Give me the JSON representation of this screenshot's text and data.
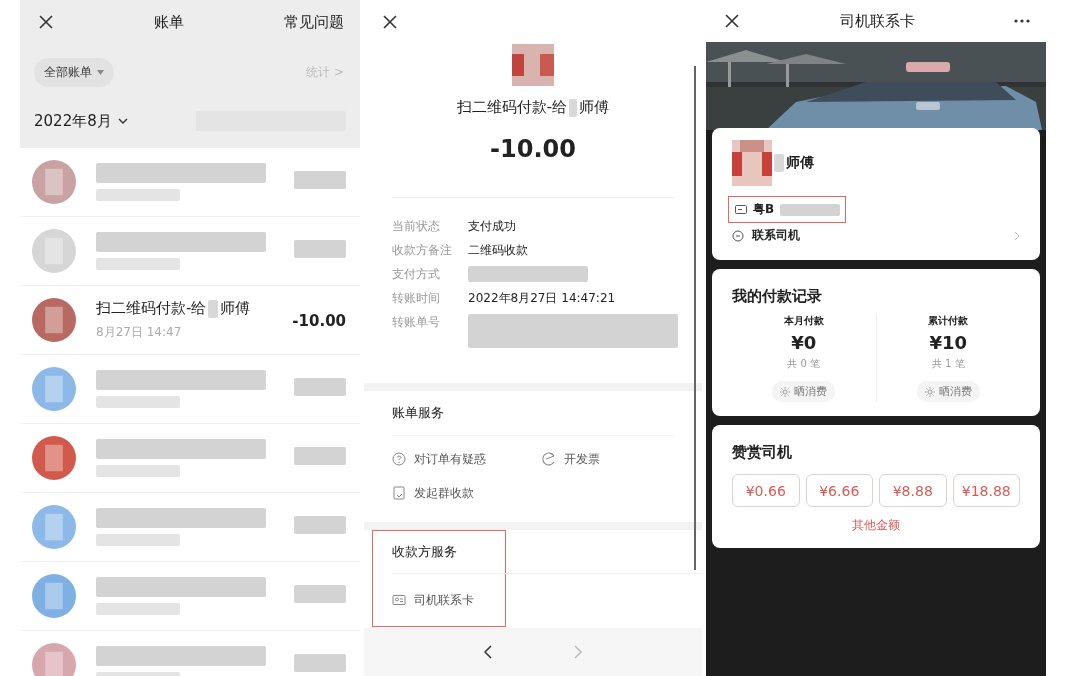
{
  "bill_list": {
    "title": "账单",
    "faq_link": "常见问题",
    "filter": "全部账单",
    "stats_link": "统计 >",
    "month": "2022年8月",
    "rows": [
      {
        "kind": "redacted",
        "color": "#c9a3a3"
      },
      {
        "kind": "redacted",
        "color": "#d6d6d6"
      },
      {
        "kind": "entry",
        "color": "#b86a62",
        "title_before": "扫二维码付款-给",
        "title_after": "师傅",
        "time": "8月27日 14:47",
        "amount": "-10.00"
      },
      {
        "kind": "redacted",
        "color": "#8db9e8"
      },
      {
        "kind": "redacted",
        "color": "#d25a4c"
      },
      {
        "kind": "redacted",
        "color": "#8db9e8"
      },
      {
        "kind": "redacted",
        "color": "#7fb0e4"
      },
      {
        "kind": "redacted",
        "color": "#d8a7ae"
      }
    ]
  },
  "bill_detail": {
    "title_before": "扫二维码付款-给",
    "title_after": "师傅",
    "amount": "-10.00",
    "details": [
      {
        "label": "当前状态",
        "value": "支付成功",
        "redacted": false
      },
      {
        "label": "收款方备注",
        "value": "二维码收款",
        "redacted": false
      },
      {
        "label": "支付方式",
        "redacted": true
      },
      {
        "label": "转账时间",
        "value": "2022年8月27日 14:47:21",
        "redacted": false
      },
      {
        "label": "转账单号",
        "redacted": true
      }
    ],
    "sections": [
      {
        "title": "账单服务",
        "highlighted": false,
        "items": [
          {
            "kind": "question",
            "label": "对订单有疑惑"
          },
          {
            "kind": "invoice",
            "label": "开发票"
          },
          {
            "kind": "group",
            "label": "发起群收款"
          }
        ]
      },
      {
        "title": "收款方服务",
        "highlighted": true,
        "items": [
          {
            "kind": "card",
            "label": "司机联系卡"
          }
        ]
      }
    ],
    "nav": [
      {
        "kind": "back",
        "disabled": false
      },
      {
        "kind": "forward",
        "disabled": true
      }
    ]
  },
  "driver_card": {
    "title": "司机联系卡",
    "driver_suffix": "师傅",
    "plate": "粤B",
    "plate_highlighted": true,
    "contact": "联系司机",
    "records": {
      "title": "我的付款记录",
      "columns": [
        {
          "label": "本月付款",
          "amount": "¥0",
          "count": "共 0 笔",
          "share": "晒消费"
        },
        {
          "label": "累计付款",
          "amount": "¥10",
          "count": "共 1 笔",
          "share": "晒消费"
        }
      ]
    },
    "tip": {
      "title": "赞赏司机",
      "amounts": [
        "¥0.66",
        "¥6.66",
        "¥8.88",
        "¥18.88"
      ],
      "other": "其他金额"
    }
  }
}
